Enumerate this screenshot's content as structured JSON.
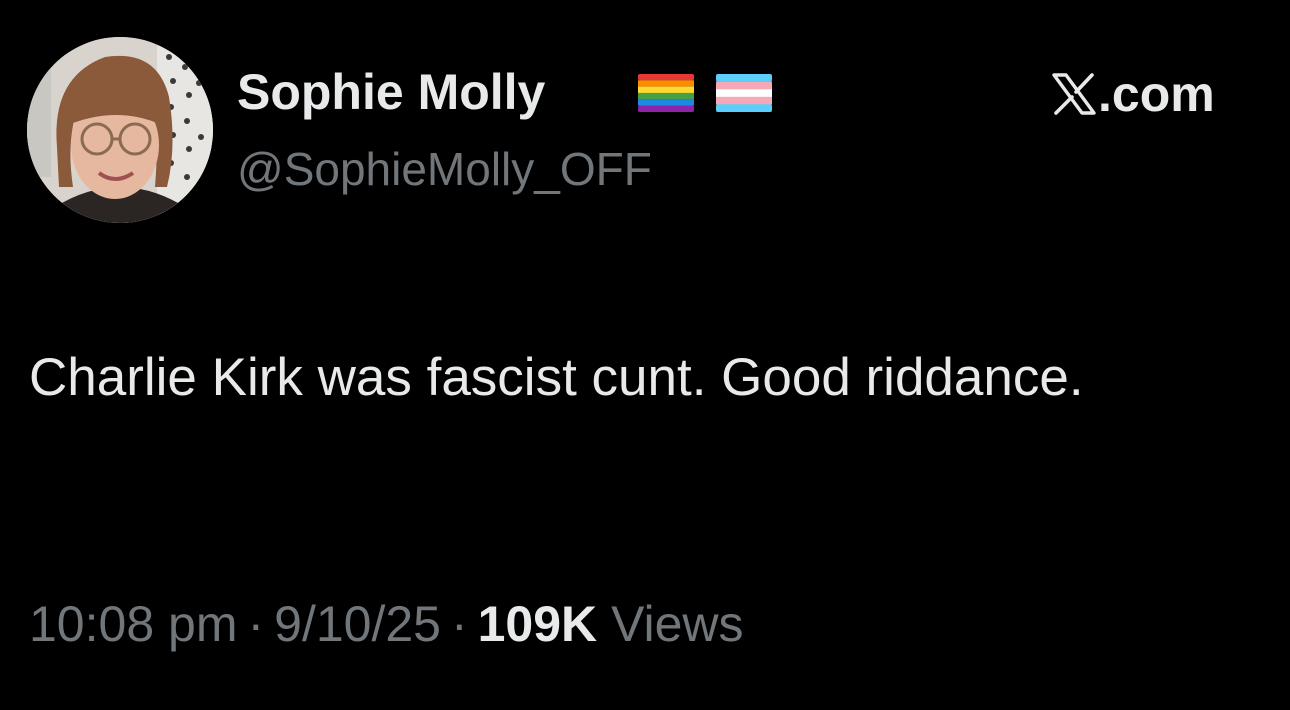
{
  "author": {
    "name": "Sophie Molly",
    "handle": "@SophieMolly_OFF",
    "flags": [
      "rainbow-pride-flag-icon",
      "transgender-flag-icon"
    ]
  },
  "site": {
    "label": ".com",
    "logo_icon": "x-logo-icon"
  },
  "tweet": {
    "text": "Charlie Kirk was fascist cunt. Good riddance."
  },
  "meta": {
    "time": "10:08 pm",
    "date": "9/10/25",
    "separator": "·",
    "views_count": "109K",
    "views_label": "Views"
  },
  "colors": {
    "background": "#000000",
    "primary_text": "#e7e9ea",
    "secondary_text": "#71767b"
  }
}
